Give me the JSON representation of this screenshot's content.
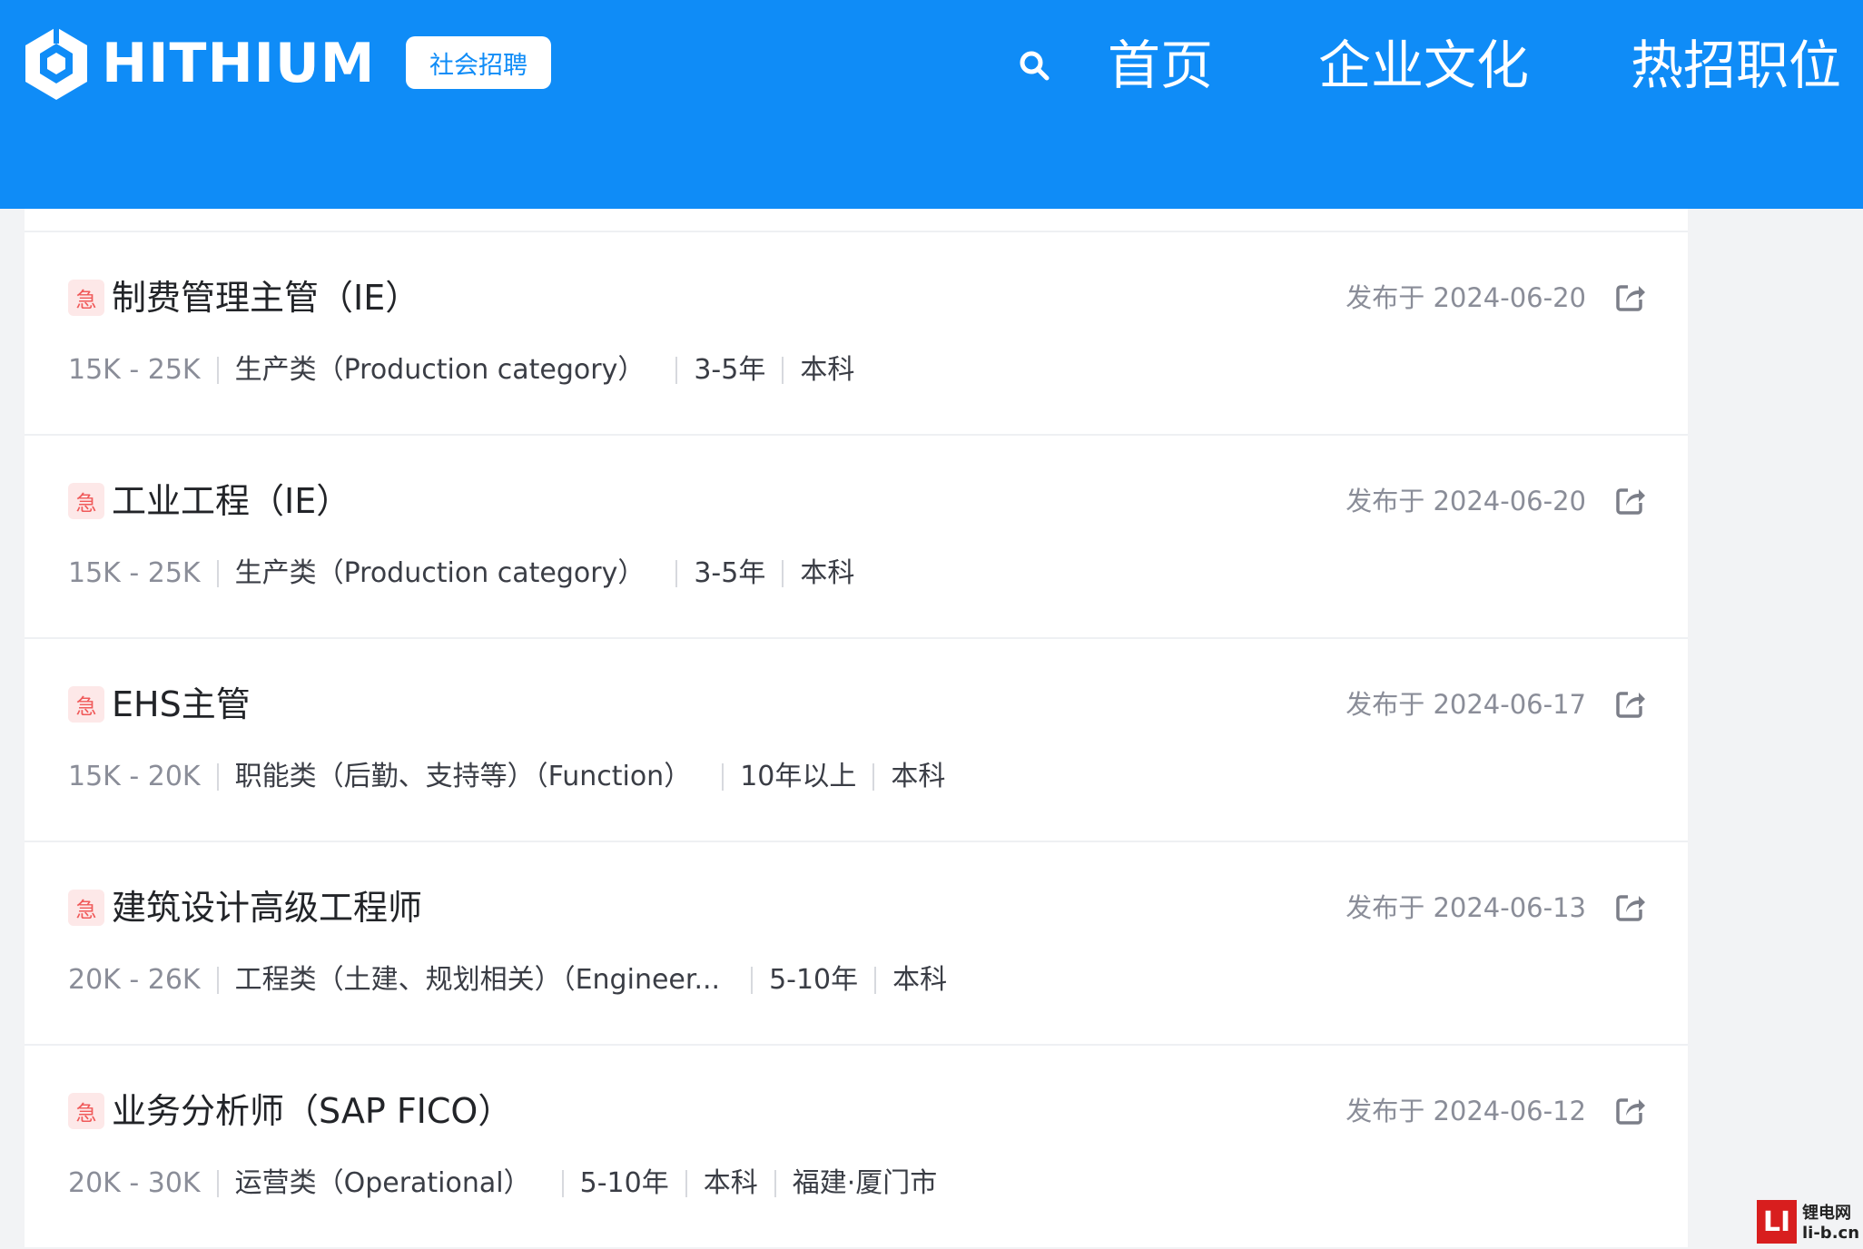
{
  "header": {
    "logo_text": "HITHIUM",
    "tag_label": "社会招聘",
    "nav": {
      "home": "首页",
      "culture": "企业文化",
      "jobs": "热招职位"
    }
  },
  "jobs": [
    {
      "urgent": "急",
      "title": "制费管理主管（IE）",
      "date": "发布于 2024-06-20",
      "salary": "15K - 25K",
      "category": "生产类（Production category）",
      "experience": "3-5年",
      "education": "本科",
      "location": ""
    },
    {
      "urgent": "急",
      "title": "工业工程（IE）",
      "date": "发布于 2024-06-20",
      "salary": "15K - 25K",
      "category": "生产类（Production category）",
      "experience": "3-5年",
      "education": "本科",
      "location": ""
    },
    {
      "urgent": "急",
      "title": "EHS主管",
      "date": "发布于 2024-06-17",
      "salary": "15K - 20K",
      "category": "职能类（后勤、支持等）（Function）",
      "experience": "10年以上",
      "education": "本科",
      "location": ""
    },
    {
      "urgent": "急",
      "title": "建筑设计高级工程师",
      "date": "发布于 2024-06-13",
      "salary": "20K - 26K",
      "category": "工程类（土建、规划相关）（Engineer...",
      "experience": "5-10年",
      "education": "本科",
      "location": ""
    },
    {
      "urgent": "急",
      "title": "业务分析师（SAP FICO）",
      "date": "发布于 2024-06-12",
      "salary": "20K - 30K",
      "category": "运营类（Operational）",
      "experience": "5-10年",
      "education": "本科",
      "location": "福建·厦门市"
    }
  ],
  "watermark": {
    "badge": "LI",
    "line1": "锂电网",
    "line2": "li-b.cn"
  },
  "colors": {
    "header_bg": "#0f8cf7",
    "urgent_bg": "#fde8e8",
    "urgent_text": "#f05a5a"
  },
  "icons": [
    "logo-hexagon-icon",
    "search-icon",
    "share-icon"
  ]
}
